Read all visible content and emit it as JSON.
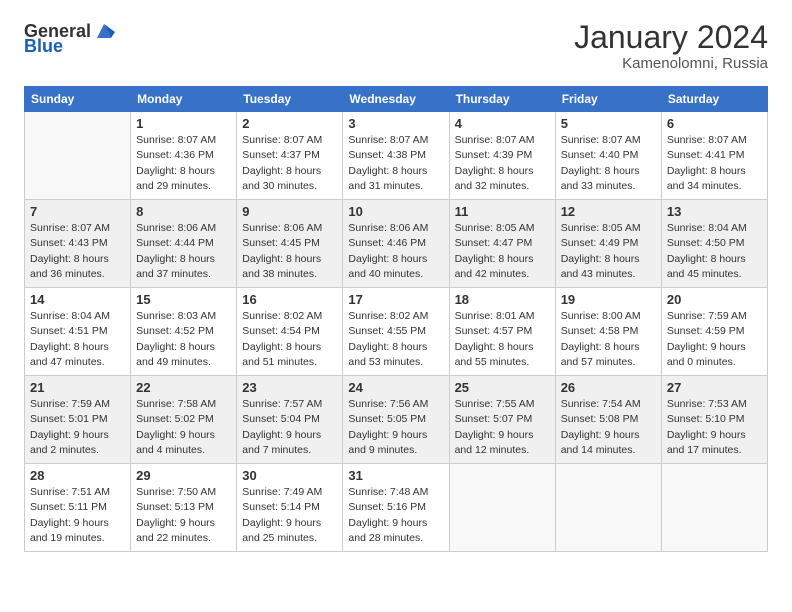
{
  "logo": {
    "general": "General",
    "blue": "Blue"
  },
  "title": "January 2024",
  "location": "Kamenolomni, Russia",
  "weekdays": [
    "Sunday",
    "Monday",
    "Tuesday",
    "Wednesday",
    "Thursday",
    "Friday",
    "Saturday"
  ],
  "weeks": [
    [
      {
        "day": "",
        "sunrise": "",
        "sunset": "",
        "daylight": "",
        "empty": true
      },
      {
        "day": "1",
        "sunrise": "Sunrise: 8:07 AM",
        "sunset": "Sunset: 4:36 PM",
        "daylight": "Daylight: 8 hours and 29 minutes."
      },
      {
        "day": "2",
        "sunrise": "Sunrise: 8:07 AM",
        "sunset": "Sunset: 4:37 PM",
        "daylight": "Daylight: 8 hours and 30 minutes."
      },
      {
        "day": "3",
        "sunrise": "Sunrise: 8:07 AM",
        "sunset": "Sunset: 4:38 PM",
        "daylight": "Daylight: 8 hours and 31 minutes."
      },
      {
        "day": "4",
        "sunrise": "Sunrise: 8:07 AM",
        "sunset": "Sunset: 4:39 PM",
        "daylight": "Daylight: 8 hours and 32 minutes."
      },
      {
        "day": "5",
        "sunrise": "Sunrise: 8:07 AM",
        "sunset": "Sunset: 4:40 PM",
        "daylight": "Daylight: 8 hours and 33 minutes."
      },
      {
        "day": "6",
        "sunrise": "Sunrise: 8:07 AM",
        "sunset": "Sunset: 4:41 PM",
        "daylight": "Daylight: 8 hours and 34 minutes."
      }
    ],
    [
      {
        "day": "7",
        "sunrise": "Sunrise: 8:07 AM",
        "sunset": "Sunset: 4:43 PM",
        "daylight": "Daylight: 8 hours and 36 minutes."
      },
      {
        "day": "8",
        "sunrise": "Sunrise: 8:06 AM",
        "sunset": "Sunset: 4:44 PM",
        "daylight": "Daylight: 8 hours and 37 minutes."
      },
      {
        "day": "9",
        "sunrise": "Sunrise: 8:06 AM",
        "sunset": "Sunset: 4:45 PM",
        "daylight": "Daylight: 8 hours and 38 minutes."
      },
      {
        "day": "10",
        "sunrise": "Sunrise: 8:06 AM",
        "sunset": "Sunset: 4:46 PM",
        "daylight": "Daylight: 8 hours and 40 minutes."
      },
      {
        "day": "11",
        "sunrise": "Sunrise: 8:05 AM",
        "sunset": "Sunset: 4:47 PM",
        "daylight": "Daylight: 8 hours and 42 minutes."
      },
      {
        "day": "12",
        "sunrise": "Sunrise: 8:05 AM",
        "sunset": "Sunset: 4:49 PM",
        "daylight": "Daylight: 8 hours and 43 minutes."
      },
      {
        "day": "13",
        "sunrise": "Sunrise: 8:04 AM",
        "sunset": "Sunset: 4:50 PM",
        "daylight": "Daylight: 8 hours and 45 minutes."
      }
    ],
    [
      {
        "day": "14",
        "sunrise": "Sunrise: 8:04 AM",
        "sunset": "Sunset: 4:51 PM",
        "daylight": "Daylight: 8 hours and 47 minutes."
      },
      {
        "day": "15",
        "sunrise": "Sunrise: 8:03 AM",
        "sunset": "Sunset: 4:52 PM",
        "daylight": "Daylight: 8 hours and 49 minutes."
      },
      {
        "day": "16",
        "sunrise": "Sunrise: 8:02 AM",
        "sunset": "Sunset: 4:54 PM",
        "daylight": "Daylight: 8 hours and 51 minutes."
      },
      {
        "day": "17",
        "sunrise": "Sunrise: 8:02 AM",
        "sunset": "Sunset: 4:55 PM",
        "daylight": "Daylight: 8 hours and 53 minutes."
      },
      {
        "day": "18",
        "sunrise": "Sunrise: 8:01 AM",
        "sunset": "Sunset: 4:57 PM",
        "daylight": "Daylight: 8 hours and 55 minutes."
      },
      {
        "day": "19",
        "sunrise": "Sunrise: 8:00 AM",
        "sunset": "Sunset: 4:58 PM",
        "daylight": "Daylight: 8 hours and 57 minutes."
      },
      {
        "day": "20",
        "sunrise": "Sunrise: 7:59 AM",
        "sunset": "Sunset: 4:59 PM",
        "daylight": "Daylight: 9 hours and 0 minutes."
      }
    ],
    [
      {
        "day": "21",
        "sunrise": "Sunrise: 7:59 AM",
        "sunset": "Sunset: 5:01 PM",
        "daylight": "Daylight: 9 hours and 2 minutes."
      },
      {
        "day": "22",
        "sunrise": "Sunrise: 7:58 AM",
        "sunset": "Sunset: 5:02 PM",
        "daylight": "Daylight: 9 hours and 4 minutes."
      },
      {
        "day": "23",
        "sunrise": "Sunrise: 7:57 AM",
        "sunset": "Sunset: 5:04 PM",
        "daylight": "Daylight: 9 hours and 7 minutes."
      },
      {
        "day": "24",
        "sunrise": "Sunrise: 7:56 AM",
        "sunset": "Sunset: 5:05 PM",
        "daylight": "Daylight: 9 hours and 9 minutes."
      },
      {
        "day": "25",
        "sunrise": "Sunrise: 7:55 AM",
        "sunset": "Sunset: 5:07 PM",
        "daylight": "Daylight: 9 hours and 12 minutes."
      },
      {
        "day": "26",
        "sunrise": "Sunrise: 7:54 AM",
        "sunset": "Sunset: 5:08 PM",
        "daylight": "Daylight: 9 hours and 14 minutes."
      },
      {
        "day": "27",
        "sunrise": "Sunrise: 7:53 AM",
        "sunset": "Sunset: 5:10 PM",
        "daylight": "Daylight: 9 hours and 17 minutes."
      }
    ],
    [
      {
        "day": "28",
        "sunrise": "Sunrise: 7:51 AM",
        "sunset": "Sunset: 5:11 PM",
        "daylight": "Daylight: 9 hours and 19 minutes."
      },
      {
        "day": "29",
        "sunrise": "Sunrise: 7:50 AM",
        "sunset": "Sunset: 5:13 PM",
        "daylight": "Daylight: 9 hours and 22 minutes."
      },
      {
        "day": "30",
        "sunrise": "Sunrise: 7:49 AM",
        "sunset": "Sunset: 5:14 PM",
        "daylight": "Daylight: 9 hours and 25 minutes."
      },
      {
        "day": "31",
        "sunrise": "Sunrise: 7:48 AM",
        "sunset": "Sunset: 5:16 PM",
        "daylight": "Daylight: 9 hours and 28 minutes."
      },
      {
        "day": "",
        "empty": true
      },
      {
        "day": "",
        "empty": true
      },
      {
        "day": "",
        "empty": true
      }
    ]
  ]
}
